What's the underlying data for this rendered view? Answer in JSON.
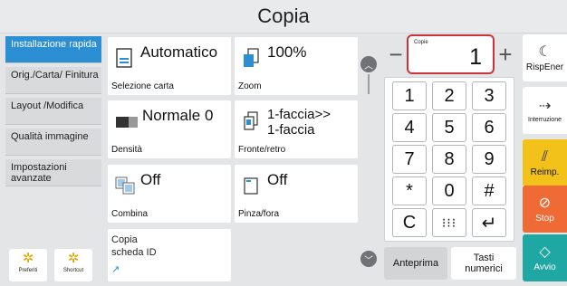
{
  "header": {
    "title": "Copia"
  },
  "sidebar": {
    "items": [
      {
        "label": "Installazione rapida",
        "active": true
      },
      {
        "label": "Orig./Carta/ Finitura"
      },
      {
        "label": "Layout /Modifica"
      },
      {
        "label": "Qualità immagine"
      },
      {
        "label": "Impostazioni avanzate"
      }
    ],
    "bottom": [
      {
        "label": "Preferiti",
        "icon": "gear-star-icon"
      },
      {
        "label": "Shortcut",
        "icon": "gear-shortcut-icon"
      }
    ]
  },
  "functions": {
    "paper": {
      "value": "Automatico",
      "caption": "Selezione carta"
    },
    "zoom": {
      "value": "100%",
      "caption": "Zoom"
    },
    "density": {
      "value": "Normale 0",
      "caption": "Densità"
    },
    "duplex": {
      "value_line1": "1-faccia>>",
      "value_line2": "1-faccia",
      "caption": "Fronte/retro"
    },
    "combine": {
      "value": "Off",
      "caption": "Combina"
    },
    "staple": {
      "value": "Off",
      "caption": "Pinza/fora"
    },
    "idcard": {
      "line1": "Copia",
      "line2": "scheda ID"
    }
  },
  "copies": {
    "label": "Copie",
    "value": "1",
    "minus": "−",
    "plus": "+"
  },
  "keypad": {
    "keys": [
      "1",
      "2",
      "3",
      "4",
      "5",
      "6",
      "7",
      "8",
      "9",
      "*",
      "0",
      "#"
    ],
    "clear": "C",
    "enter_symbol": "↵"
  },
  "bottom": {
    "preview": "Anteprima",
    "numeric_keys_line1": "Tasti",
    "numeric_keys_line2": "numerici"
  },
  "right_panel": {
    "energy": "RispEner",
    "interrupt": "Interruzione",
    "reset": "Reimp.",
    "stop": "Stop",
    "start": "Avvio"
  },
  "colors": {
    "accent_blue": "#2c8ed3",
    "reset_yellow": "#f2c21a",
    "stop_orange": "#f06a35",
    "start_teal": "#1fa7a4",
    "highlight_red": "#c9343a"
  }
}
